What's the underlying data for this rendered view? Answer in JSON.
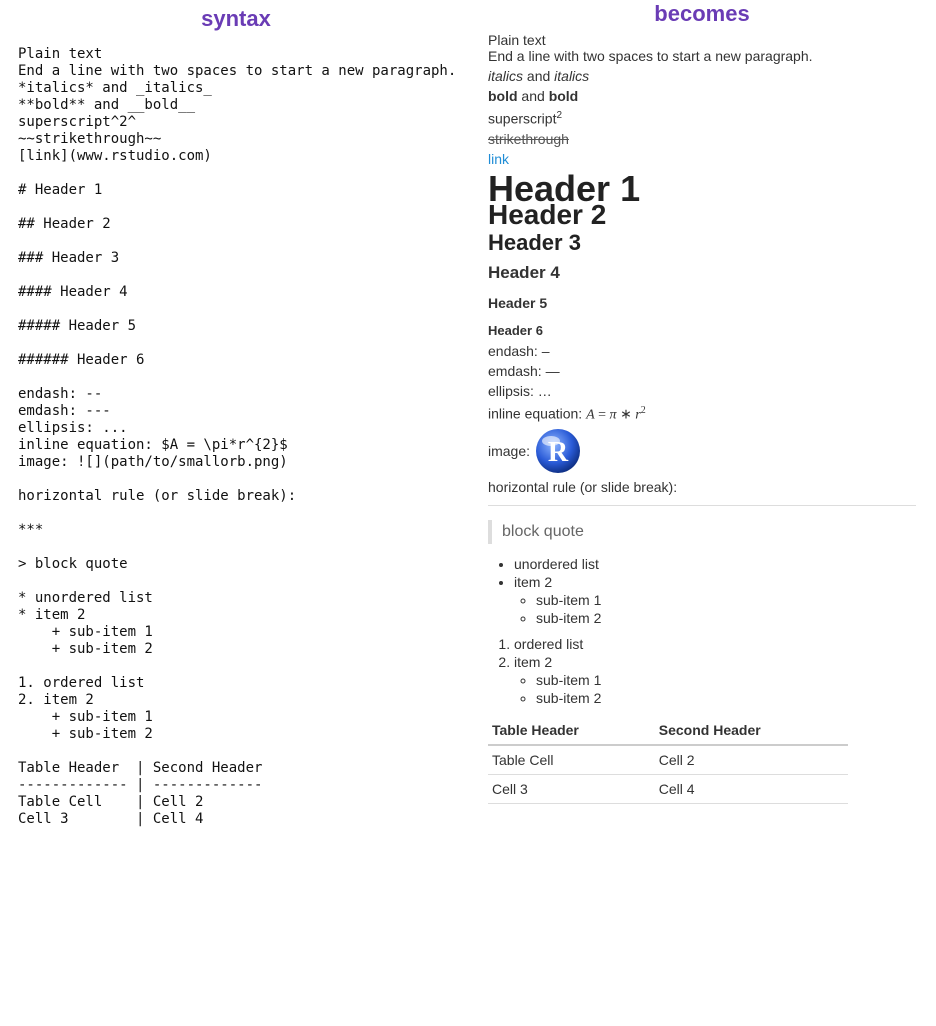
{
  "titles": {
    "left": "syntax",
    "right": "becomes"
  },
  "syntax_block": "Plain text\nEnd a line with two spaces to start a new paragraph.\n*italics* and _italics_\n**bold** and __bold__\nsuperscript^2^\n~~strikethrough~~\n[link](www.rstudio.com)\n\n# Header 1\n\n## Header 2\n\n### Header 3\n\n#### Header 4\n\n##### Header 5\n\n###### Header 6\n\nendash: --\nemdash: ---\nellipsis: ...\ninline equation: $A = \\pi*r^{2}$\nimage: ![](path/to/smallorb.png)\n\nhorizontal rule (or slide break):\n\n***\n\n> block quote\n\n* unordered list\n* item 2\n    + sub-item 1\n    + sub-item 2\n\n1. ordered list\n2. item 2\n    + sub-item 1\n    + sub-item 2\n\nTable Header  | Second Header\n------------- | -------------\nTable Cell    | Cell 2\nCell 3        | Cell 4",
  "rendered": {
    "plain1": "Plain text",
    "plain2": "End a line with two spaces to start a new paragraph.",
    "italics": "italics",
    "and": " and ",
    "bold": "bold",
    "superscript_label": "superscript",
    "superscript_exp": "2",
    "strikethrough": "strikethrough",
    "link": "link",
    "h1": "Header 1",
    "h2": "Header 2",
    "h3": "Header 3",
    "h4": "Header 4",
    "h5": "Header 5",
    "h6": "Header 6",
    "endash_label": "endash: ",
    "endash_val": "–",
    "emdash_label": "emdash: ",
    "emdash_val": "—",
    "ellipsis_label": "ellipsis: ",
    "ellipsis_val": "…",
    "inline_eq_label": "inline equation: ",
    "inline_eq_A": "A",
    "inline_eq_eq": " = ",
    "inline_eq_pi": "π",
    "inline_eq_star": " ∗ ",
    "inline_eq_r": "r",
    "inline_eq_exp": "2",
    "image_label": "image: ",
    "hr_label": "horizontal rule (or slide break):",
    "blockquote": "block quote",
    "ul": {
      "i1": "unordered list",
      "i2": "item 2",
      "s1": "sub-item 1",
      "s2": "sub-item 2"
    },
    "ol": {
      "i1": "ordered list",
      "i2": "item 2",
      "s1": "sub-item 1",
      "s2": "sub-item 2"
    },
    "table": {
      "head1": "Table Header",
      "head2": "Second Header",
      "r1c1": "Table Cell",
      "r1c2": "Cell 2",
      "r2c1": "Cell 3",
      "r2c2": "Cell 4"
    }
  }
}
